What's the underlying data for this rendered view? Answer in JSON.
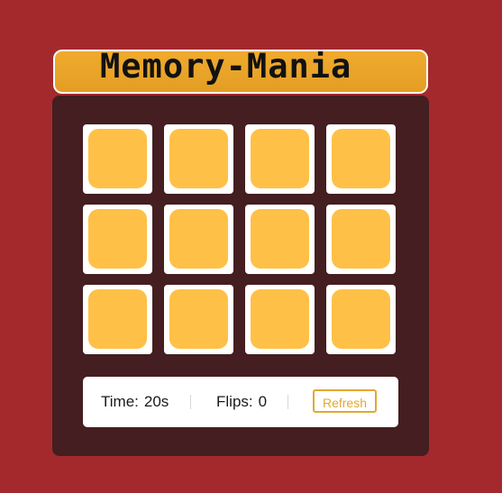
{
  "app": {
    "title": "Memory-Mania"
  },
  "board": {
    "cards": [
      {
        "state": "face-down"
      },
      {
        "state": "face-down"
      },
      {
        "state": "face-down"
      },
      {
        "state": "face-down"
      },
      {
        "state": "face-down"
      },
      {
        "state": "face-down"
      },
      {
        "state": "face-down"
      },
      {
        "state": "face-down"
      },
      {
        "state": "face-down"
      },
      {
        "state": "face-down"
      },
      {
        "state": "face-down"
      },
      {
        "state": "face-down"
      }
    ]
  },
  "stats": {
    "time_label": "Time:",
    "time_value": "20s",
    "flips_label": "Flips:",
    "flips_value": "0",
    "refresh_label": "Refresh"
  },
  "colors": {
    "background": "#a4292d",
    "board": "#441e20",
    "title_bar": "#e8a428",
    "card_back": "#ffc047",
    "card_frame": "#ffffff",
    "accent": "#e3a832"
  }
}
